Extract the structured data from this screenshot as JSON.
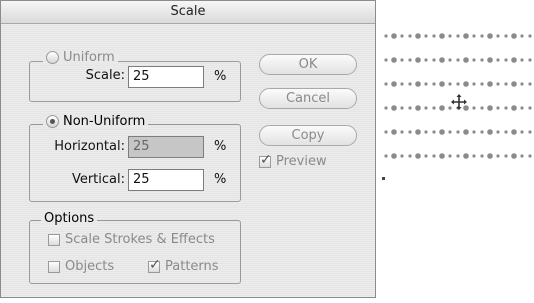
{
  "dialog": {
    "title": "Scale"
  },
  "uniform": {
    "label": "Uniform",
    "scale_label": "Scale:",
    "scale_value": "25",
    "unit": "%"
  },
  "non_uniform": {
    "label": "Non-Uniform",
    "horizontal_label": "Horizontal:",
    "horizontal_value": "25",
    "vertical_label": "Vertical:",
    "vertical_value": "25",
    "unit": "%"
  },
  "options": {
    "label": "Options",
    "scale_strokes": {
      "label": "Scale Strokes & Effects",
      "checked": false
    },
    "objects": {
      "label": "Objects",
      "checked": false
    },
    "patterns": {
      "label": "Patterns",
      "checked": true
    }
  },
  "buttons": {
    "ok": "OK",
    "cancel": "Cancel",
    "copy": "Copy"
  },
  "preview": {
    "label": "Preview",
    "checked": true
  }
}
